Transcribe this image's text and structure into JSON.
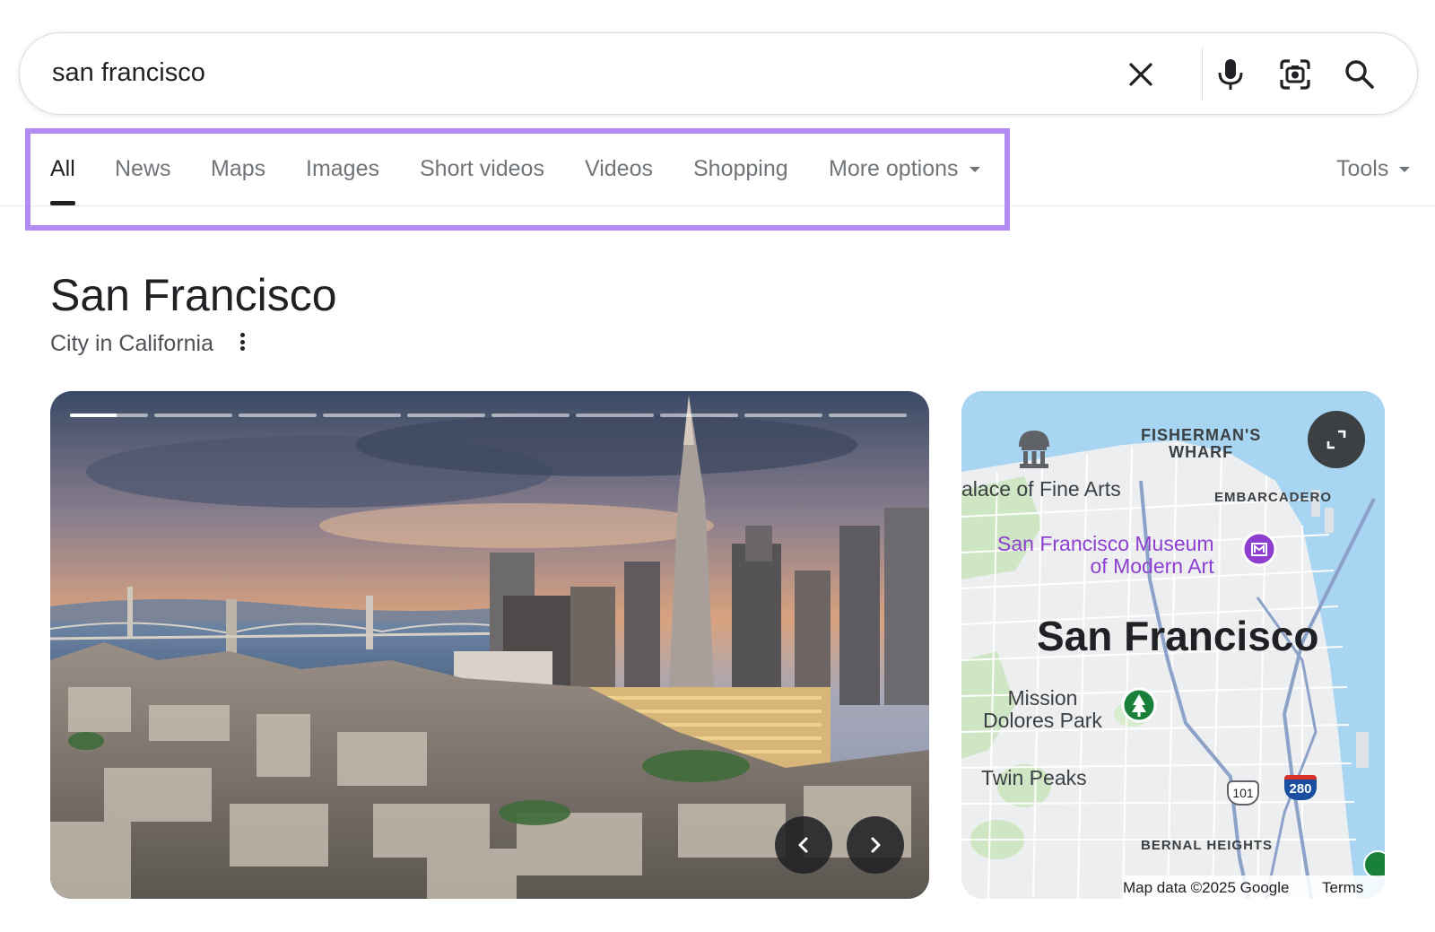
{
  "search": {
    "query": "san francisco"
  },
  "tabs": [
    {
      "label": "All",
      "active": true
    },
    {
      "label": "News"
    },
    {
      "label": "Maps"
    },
    {
      "label": "Images"
    },
    {
      "label": "Short videos"
    },
    {
      "label": "Videos"
    },
    {
      "label": "Shopping"
    },
    {
      "label": "More options",
      "dropdown": true
    }
  ],
  "tools": {
    "label": "Tools"
  },
  "entity": {
    "title": "San Francisco",
    "subtitle": "City in California"
  },
  "photo_carousel": {
    "segments": 10,
    "current_segment": 1,
    "current_segment_progress": 0.6
  },
  "map": {
    "labels": {
      "fishermans_wharf_line1": "FISHERMAN'S",
      "fishermans_wharf_line2": "WHARF",
      "palace": "alace of Fine Arts",
      "embarcadero": "EMBARCADERO",
      "sfmoma_line1": "San Francisco Museum",
      "sfmoma_line2": "of Modern Art",
      "city": "San Francisco",
      "mission_line1": "Mission",
      "mission_line2": "Dolores Park",
      "twin_peaks": "Twin Peaks",
      "bernal": "BERNAL HEIGHTS",
      "hwy101": "101",
      "hwy280": "280"
    },
    "attribution": "Map data ©2025 Google",
    "terms": "Terms"
  },
  "colors": {
    "highlight": "#b28cf2",
    "poi_purple": "#8e3fcf",
    "park_green": "#188038",
    "water": "#a7d5f2"
  },
  "icons": {
    "clear": "close-icon",
    "voice": "microphone-icon",
    "lens": "camera-lens-icon",
    "search": "search-icon",
    "expand": "expand-icon"
  }
}
